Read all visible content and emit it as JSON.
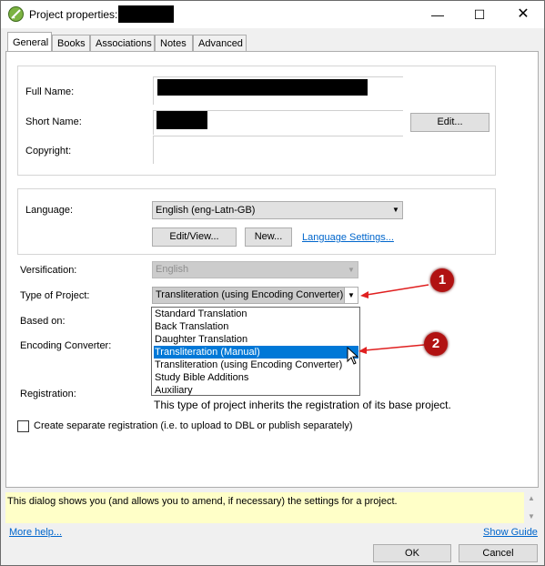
{
  "window": {
    "title": "Project properties:",
    "minimize_glyph": "—",
    "maximize_glyph": "☐",
    "close_glyph": "✕"
  },
  "tabs": [
    {
      "label": "General"
    },
    {
      "label": "Books"
    },
    {
      "label": "Associations"
    },
    {
      "label": "Notes"
    },
    {
      "label": "Advanced"
    }
  ],
  "names_group": {
    "full_name_label": "Full Name:",
    "short_name_label": "Short Name:",
    "copyright_label": "Copyright:",
    "edit_button": "Edit..."
  },
  "language_group": {
    "label": "Language:",
    "value": "English (eng-Latn-GB)",
    "edit_view_button": "Edit/View...",
    "new_button": "New...",
    "settings_link": "Language Settings..."
  },
  "versification": {
    "label": "Versification:",
    "value": "English"
  },
  "project_type": {
    "label": "Type of Project:",
    "value": "Transliteration (using Encoding Converter)",
    "options": [
      "Standard Translation",
      "Back Translation",
      "Daughter Translation",
      "Transliteration (Manual)",
      "Transliteration (using Encoding Converter)",
      "Study Bible Additions",
      "Auxiliary"
    ],
    "highlighted_index": 3
  },
  "based_on": {
    "label": "Based on:"
  },
  "encoding_converter": {
    "label": "Encoding Converter:"
  },
  "registration": {
    "label": "Registration:",
    "text": "This type of project inherits the registration of its base project."
  },
  "separate_registration": {
    "label": "Create separate registration (i.e. to upload to DBL or publish separately)",
    "checked": false
  },
  "info": {
    "text": "This dialog shows you (and allows you to amend, if necessary) the settings for a project."
  },
  "footer": {
    "more_help": "More help...",
    "show_guide": "Show Guide",
    "ok": "OK",
    "cancel": "Cancel"
  },
  "annotations": {
    "marker_1": "1",
    "marker_2": "2",
    "arrow_color": "#e02020"
  }
}
